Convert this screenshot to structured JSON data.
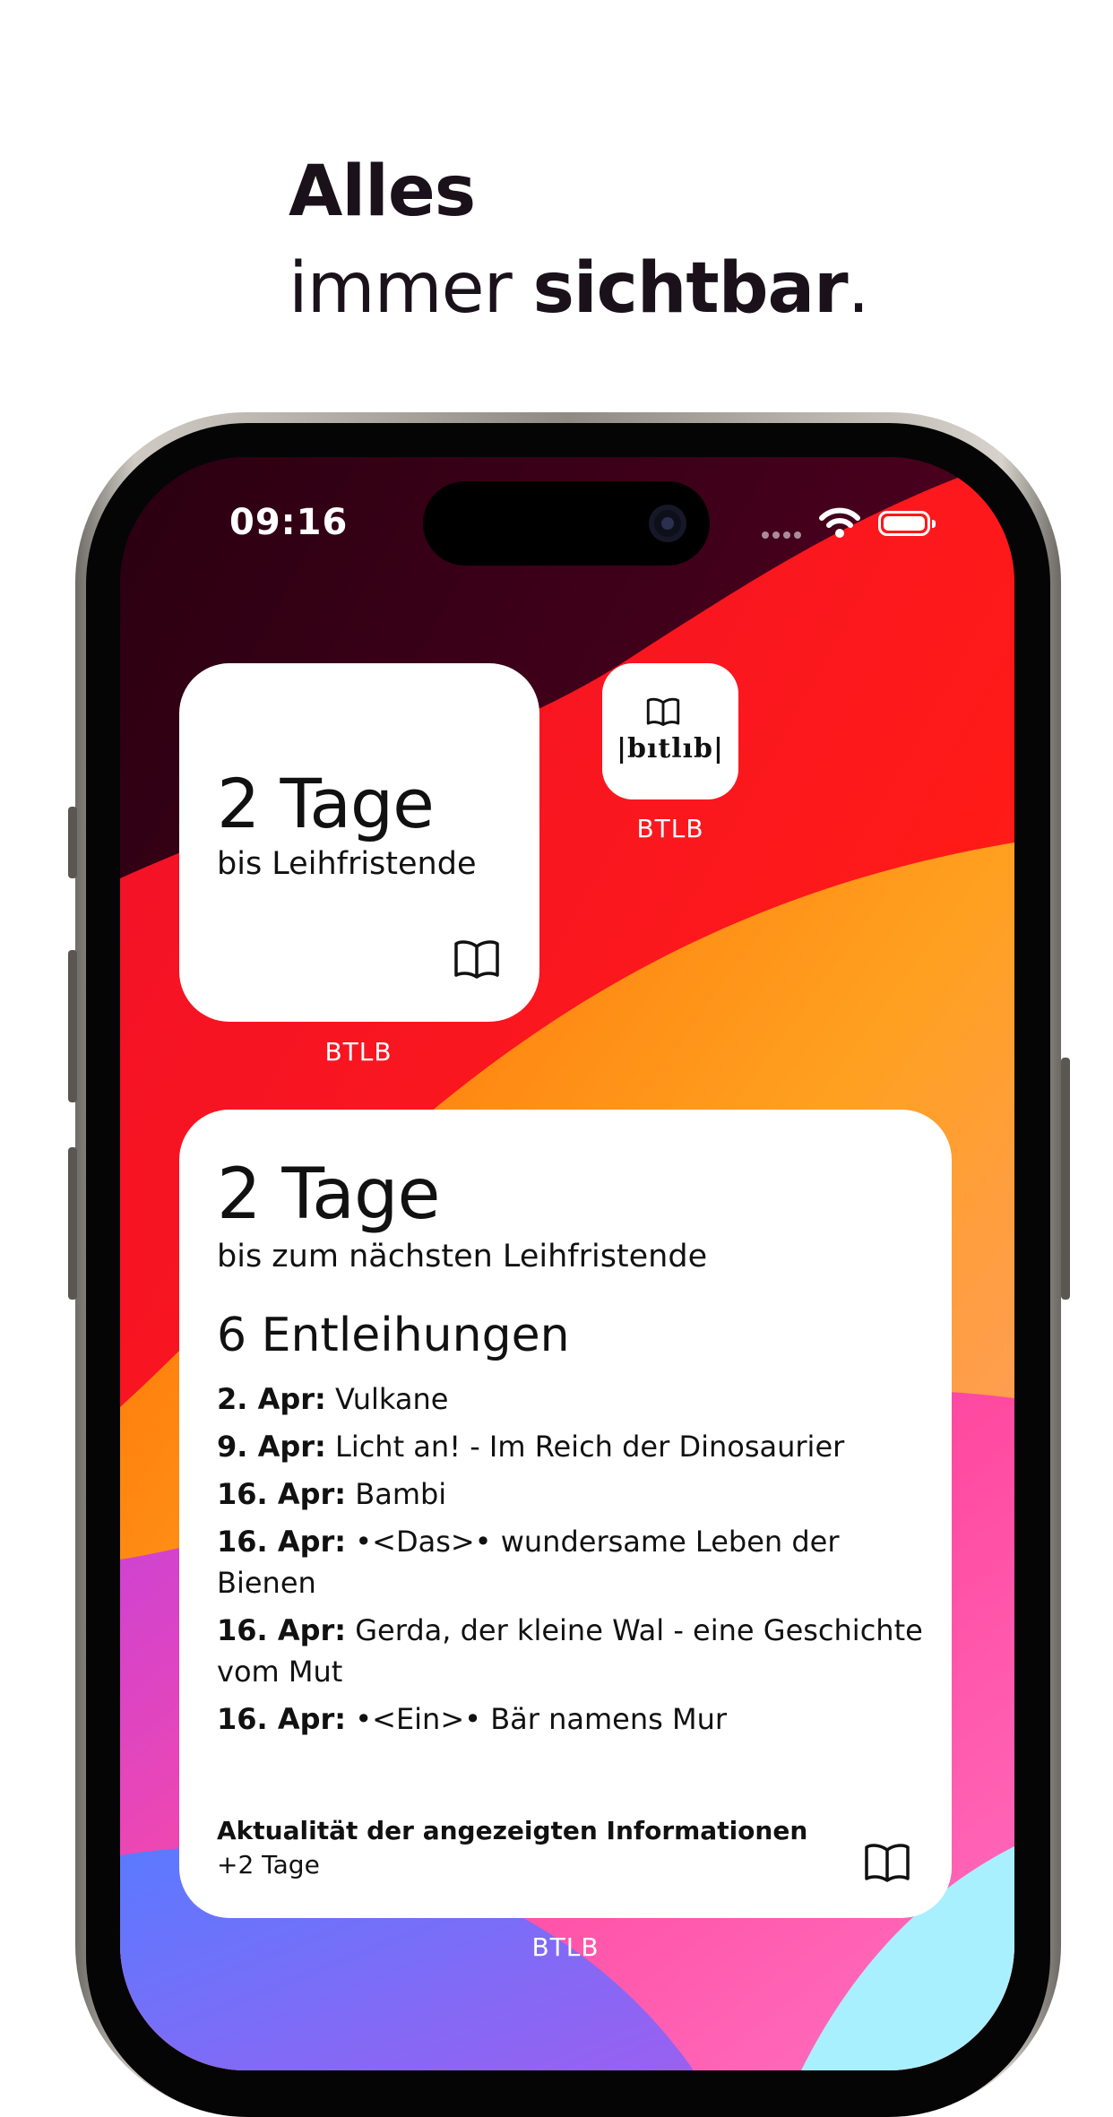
{
  "headline": {
    "line1": "Alles",
    "line2_light": "immer ",
    "line2_bold": "sichtbar",
    "line2_end": "."
  },
  "status_bar": {
    "time": "09:16"
  },
  "small_widget": {
    "days": "2 Tage",
    "subtitle": "bis Leihfristende",
    "label": "BTLB",
    "icon": "book-icon"
  },
  "app_icon": {
    "logo_text": "|bıtlıb|",
    "label": "BTLB",
    "icon": "book-icon"
  },
  "large_widget": {
    "days": "2 Tage",
    "subtitle": "bis zum nächsten Leihfristende",
    "count": "6 Entleihungen",
    "loans": [
      {
        "date": "2. Apr:",
        "title": " Vulkane"
      },
      {
        "date": "9. Apr:",
        "title": " Licht an! - Im Reich der Dinosaurier"
      },
      {
        "date": "16. Apr:",
        "title": " Bambi"
      },
      {
        "date": "16. Apr:",
        "title": " •<Das>• wundersame Leben der Bienen"
      },
      {
        "date": "16. Apr:",
        "title": " Gerda, der kleine Wal - eine Geschichte vom Mut"
      },
      {
        "date": "16. Apr:",
        "title": " •<Ein>• Bär namens Mur"
      }
    ],
    "footer_title": "Aktualität der angezeigten Informationen",
    "footer_value": "+2 Tage",
    "label": "BTLB",
    "icon": "book-icon"
  },
  "colors": {
    "text": "#111111",
    "headline": "#1a111b",
    "widget_bg": "#ffffff"
  }
}
